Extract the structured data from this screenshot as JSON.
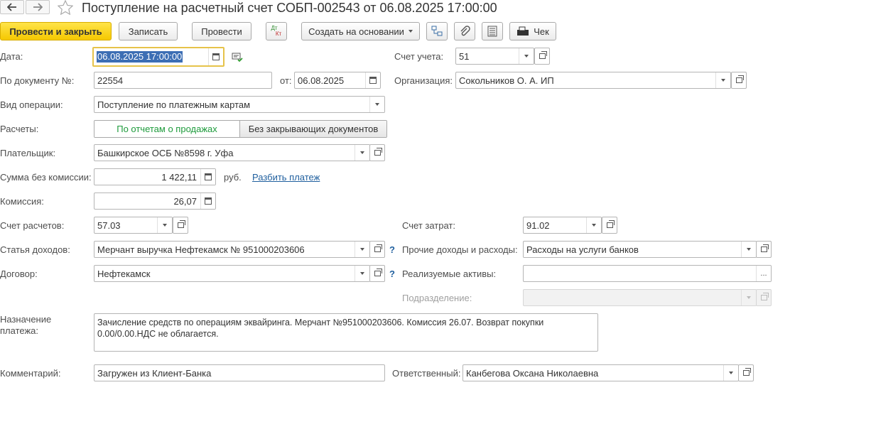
{
  "header": {
    "title": "Поступление на расчетный счет СОБП-002543 от 06.08.2025 17:00:00"
  },
  "toolbar": {
    "post_close": "Провести и закрыть",
    "save": "Записать",
    "post": "Провести",
    "dtkt_top": "Дт",
    "dtkt_bottom": "Кт",
    "create_based": "Создать на основании",
    "receipt": "Чек"
  },
  "form": {
    "date": {
      "label": "Дата:",
      "value": "06.08.2025 17:00:00"
    },
    "account": {
      "label": "Счет учета:",
      "value": "51"
    },
    "doc_number": {
      "label": "По документу №:",
      "value": "22554"
    },
    "doc_from": {
      "label": "от:",
      "value": "06.08.2025"
    },
    "organization": {
      "label": "Организация:",
      "value": "Сокольников О. А. ИП"
    },
    "operation_type": {
      "label": "Вид операции:",
      "value": "Поступление по платежным картам"
    },
    "settlements": {
      "label": "Расчеты:",
      "option1": "По отчетам о продажах",
      "option2": "Без закрывающих документов"
    },
    "payer": {
      "label": "Плательщик:",
      "value": "Башкирское ОСБ №8598 г. Уфа"
    },
    "amount": {
      "label": "Сумма без комиссии:",
      "value": "1 422,11",
      "currency": "руб.",
      "split_link": "Разбить платеж"
    },
    "commission": {
      "label": "Комиссия:",
      "value": "26,07"
    },
    "settlement_account": {
      "label": "Счет расчетов:",
      "value": "57.03"
    },
    "expense_account": {
      "label": "Счет затрат:",
      "value": "91.02"
    },
    "income_item": {
      "label": "Статья доходов:",
      "value": "Мерчант выручка Нефтекамск № 951000203606",
      "help": "?"
    },
    "other_income": {
      "label": "Прочие доходы и расходы:",
      "value": "Расходы на услуги банков"
    },
    "contract": {
      "label": "Договор:",
      "value": "Нефтекамск",
      "help": "?"
    },
    "sold_assets": {
      "label": "Реализуемые активы:",
      "value": "",
      "dots": "..."
    },
    "department": {
      "label": "Подразделение:",
      "value": ""
    },
    "purpose": {
      "label_line1": "Назначение",
      "label_line2": "платежа:",
      "line1": "Зачисление средств по операциям эквайринга. Мерчант №951000203606. Комиссия 26.07. Возврат покупки",
      "line2": "0.00/0.00.НДС не облагается."
    },
    "comment": {
      "label": "Комментарий:",
      "value": "Загружен из Клиент-Банка"
    },
    "responsible": {
      "label": "Ответственный:",
      "value": "Канбегова Оксана Николаевна"
    }
  },
  "colors": {
    "primary_button": "#f5c800",
    "link": "#1f5f9e",
    "selected_toggle_text": "#1e9b3c",
    "focus_border": "#e6c34a"
  },
  "icons": [
    "back-arrow-icon",
    "forward-arrow-icon",
    "star-icon",
    "calendar-icon",
    "chevron-down-icon",
    "open-form-icon",
    "dtkt-icon",
    "structure-icon",
    "paperclip-icon",
    "list-icon",
    "receipt-icon",
    "history-icon",
    "help-icon"
  ]
}
